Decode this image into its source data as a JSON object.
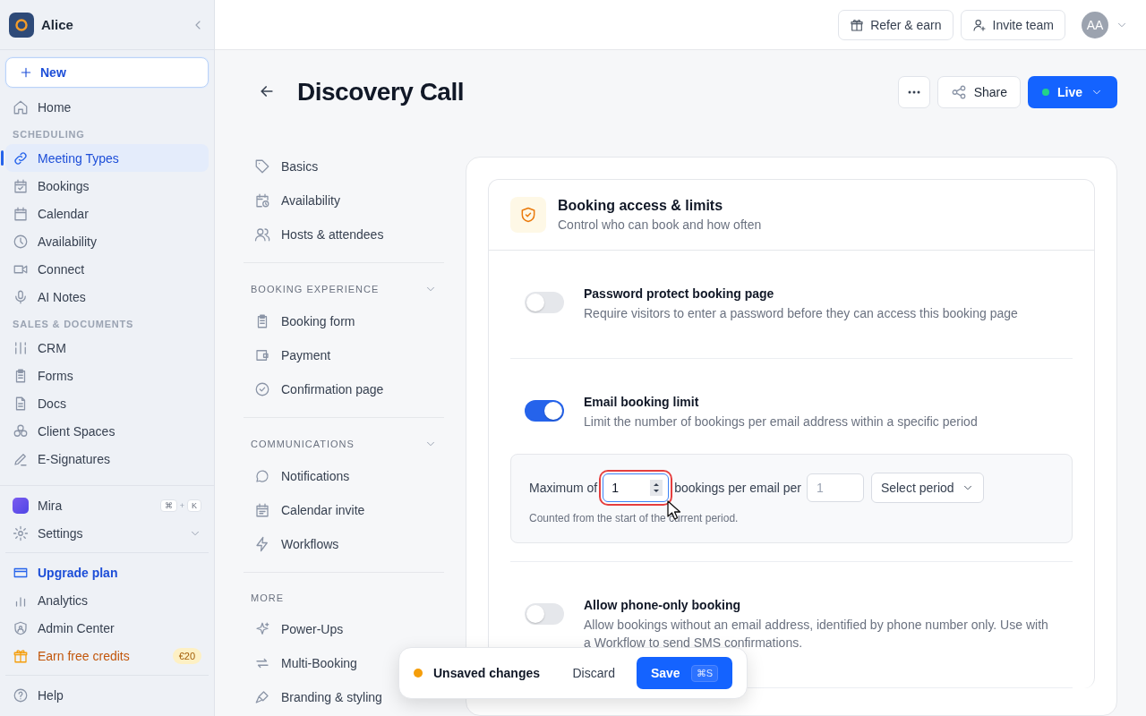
{
  "sidebar": {
    "workspace": "Alice",
    "new_button": "New",
    "nav": [
      {
        "kind": "item",
        "label": "Home",
        "selected": false
      },
      {
        "kind": "section",
        "label": "SCHEDULING"
      },
      {
        "kind": "item",
        "label": "Meeting Types",
        "selected": true
      },
      {
        "kind": "item",
        "label": "Bookings",
        "selected": false
      },
      {
        "kind": "item",
        "label": "Calendar",
        "selected": false
      },
      {
        "kind": "item",
        "label": "Availability",
        "selected": false
      },
      {
        "kind": "item",
        "label": "Connect",
        "selected": false
      },
      {
        "kind": "item",
        "label": "AI Notes",
        "selected": false
      },
      {
        "kind": "section",
        "label": "SALES & DOCUMENTS"
      },
      {
        "kind": "item",
        "label": "CRM",
        "selected": false
      },
      {
        "kind": "item",
        "label": "Forms",
        "selected": false
      },
      {
        "kind": "item",
        "label": "Docs",
        "selected": false
      },
      {
        "kind": "item",
        "label": "Client Spaces",
        "selected": false
      },
      {
        "kind": "item",
        "label": "E-Signatures",
        "selected": false
      }
    ],
    "assistant": {
      "label": "Mira",
      "keys": [
        "⌘",
        "+",
        "K"
      ]
    },
    "settings": {
      "label": "Settings"
    },
    "links": [
      {
        "kind": "upgrade",
        "label": "Upgrade plan"
      },
      {
        "kind": "plain",
        "label": "Analytics"
      },
      {
        "kind": "plain",
        "label": "Admin Center"
      },
      {
        "kind": "credits",
        "label": "Earn free credits",
        "badge": "€20"
      }
    ],
    "help": "Help"
  },
  "topbar": {
    "buttons": [
      "Refer & earn",
      "Invite team"
    ],
    "avatar": "AA"
  },
  "header": {
    "title": "Discovery Call",
    "share": "Share",
    "status": "Live"
  },
  "subnav": [
    {
      "items": [
        "Basics",
        "Availability",
        "Hosts & attendees"
      ]
    },
    {
      "title": "BOOKING EXPERIENCE",
      "expanded": true,
      "items": [
        "Booking form",
        "Payment",
        "Confirmation page"
      ]
    },
    {
      "title": "COMMUNICATIONS",
      "expanded": true,
      "items": [
        "Notifications",
        "Calendar invite",
        "Workflows"
      ]
    },
    {
      "title": "MORE",
      "items": [
        "Power-Ups",
        "Multi-Booking",
        "Branding & styling"
      ]
    }
  ],
  "card": {
    "title": "Booking access & limits",
    "subtitle": "Control who can book and how often",
    "settings": [
      {
        "title": "Password protect booking page",
        "description": "Require visitors to enter a password before they can access this booking page",
        "on": false
      },
      {
        "title": "Email booking limit",
        "description": "Limit the number of bookings per email address within a specific period",
        "on": true,
        "limit": {
          "prefix": "Maximum of",
          "value": "1",
          "focused": true,
          "middle": "bookings per email per",
          "period_count": {
            "placeholder": "1"
          },
          "period": "Select period",
          "note": "Counted from the start of the current period."
        }
      },
      {
        "title": "Allow phone-only booking",
        "description": "Allow bookings without an email address, identified by phone number only. Use with a Workflow to send SMS confirmations.",
        "on": false
      }
    ]
  },
  "unsaved": {
    "label": "Unsaved changes",
    "discard": "Discard",
    "save": "Save",
    "shortcut": "⌘S"
  }
}
